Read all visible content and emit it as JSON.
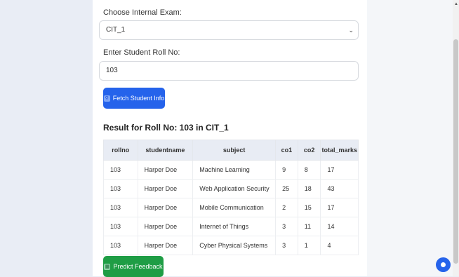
{
  "form": {
    "exam_label": "Choose Internal Exam:",
    "exam_value": "CIT_1",
    "roll_label": "Enter Student Roll No:",
    "roll_value": "103",
    "fetch_button": "Fetch Student Info"
  },
  "result": {
    "title": "Result for Roll No: 103 in CIT_1",
    "columns": [
      "rollno",
      "studentname",
      "subject",
      "co1",
      "co2",
      "total_marks"
    ],
    "rows": [
      [
        "103",
        "Harper Doe",
        "Machine Learning",
        "9",
        "8",
        "17"
      ],
      [
        "103",
        "Harper Doe",
        "Web Application Security",
        "25",
        "18",
        "43"
      ],
      [
        "103",
        "Harper Doe",
        "Mobile Communication",
        "2",
        "15",
        "17"
      ],
      [
        "103",
        "Harper Doe",
        "Internet of Things",
        "3",
        "11",
        "14"
      ],
      [
        "103",
        "Harper Doe",
        "Cyber Physical Systems",
        "3",
        "1",
        "4"
      ]
    ]
  },
  "actions": {
    "predict_button": "Predict Feedback"
  },
  "colors": {
    "primary": "#2563eb",
    "success": "#1f9d45",
    "page_bg": "#e9edf5"
  }
}
